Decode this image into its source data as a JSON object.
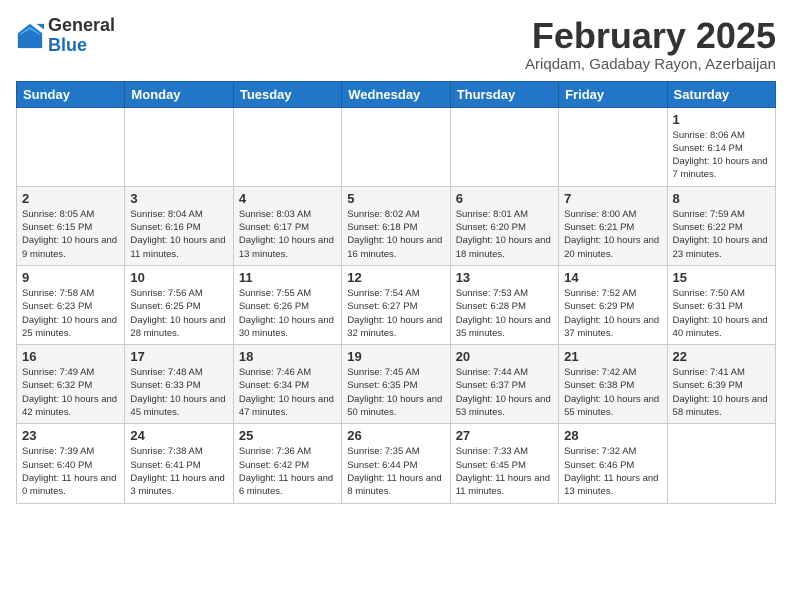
{
  "logo": {
    "general": "General",
    "blue": "Blue"
  },
  "title": "February 2025",
  "subtitle": "Ariqdam, Gadabay Rayon, Azerbaijan",
  "headers": [
    "Sunday",
    "Monday",
    "Tuesday",
    "Wednesday",
    "Thursday",
    "Friday",
    "Saturday"
  ],
  "weeks": [
    [
      {
        "day": "",
        "info": ""
      },
      {
        "day": "",
        "info": ""
      },
      {
        "day": "",
        "info": ""
      },
      {
        "day": "",
        "info": ""
      },
      {
        "day": "",
        "info": ""
      },
      {
        "day": "",
        "info": ""
      },
      {
        "day": "1",
        "info": "Sunrise: 8:06 AM\nSunset: 6:14 PM\nDaylight: 10 hours and 7 minutes."
      }
    ],
    [
      {
        "day": "2",
        "info": "Sunrise: 8:05 AM\nSunset: 6:15 PM\nDaylight: 10 hours and 9 minutes."
      },
      {
        "day": "3",
        "info": "Sunrise: 8:04 AM\nSunset: 6:16 PM\nDaylight: 10 hours and 11 minutes."
      },
      {
        "day": "4",
        "info": "Sunrise: 8:03 AM\nSunset: 6:17 PM\nDaylight: 10 hours and 13 minutes."
      },
      {
        "day": "5",
        "info": "Sunrise: 8:02 AM\nSunset: 6:18 PM\nDaylight: 10 hours and 16 minutes."
      },
      {
        "day": "6",
        "info": "Sunrise: 8:01 AM\nSunset: 6:20 PM\nDaylight: 10 hours and 18 minutes."
      },
      {
        "day": "7",
        "info": "Sunrise: 8:00 AM\nSunset: 6:21 PM\nDaylight: 10 hours and 20 minutes."
      },
      {
        "day": "8",
        "info": "Sunrise: 7:59 AM\nSunset: 6:22 PM\nDaylight: 10 hours and 23 minutes."
      }
    ],
    [
      {
        "day": "9",
        "info": "Sunrise: 7:58 AM\nSunset: 6:23 PM\nDaylight: 10 hours and 25 minutes."
      },
      {
        "day": "10",
        "info": "Sunrise: 7:56 AM\nSunset: 6:25 PM\nDaylight: 10 hours and 28 minutes."
      },
      {
        "day": "11",
        "info": "Sunrise: 7:55 AM\nSunset: 6:26 PM\nDaylight: 10 hours and 30 minutes."
      },
      {
        "day": "12",
        "info": "Sunrise: 7:54 AM\nSunset: 6:27 PM\nDaylight: 10 hours and 32 minutes."
      },
      {
        "day": "13",
        "info": "Sunrise: 7:53 AM\nSunset: 6:28 PM\nDaylight: 10 hours and 35 minutes."
      },
      {
        "day": "14",
        "info": "Sunrise: 7:52 AM\nSunset: 6:29 PM\nDaylight: 10 hours and 37 minutes."
      },
      {
        "day": "15",
        "info": "Sunrise: 7:50 AM\nSunset: 6:31 PM\nDaylight: 10 hours and 40 minutes."
      }
    ],
    [
      {
        "day": "16",
        "info": "Sunrise: 7:49 AM\nSunset: 6:32 PM\nDaylight: 10 hours and 42 minutes."
      },
      {
        "day": "17",
        "info": "Sunrise: 7:48 AM\nSunset: 6:33 PM\nDaylight: 10 hours and 45 minutes."
      },
      {
        "day": "18",
        "info": "Sunrise: 7:46 AM\nSunset: 6:34 PM\nDaylight: 10 hours and 47 minutes."
      },
      {
        "day": "19",
        "info": "Sunrise: 7:45 AM\nSunset: 6:35 PM\nDaylight: 10 hours and 50 minutes."
      },
      {
        "day": "20",
        "info": "Sunrise: 7:44 AM\nSunset: 6:37 PM\nDaylight: 10 hours and 53 minutes."
      },
      {
        "day": "21",
        "info": "Sunrise: 7:42 AM\nSunset: 6:38 PM\nDaylight: 10 hours and 55 minutes."
      },
      {
        "day": "22",
        "info": "Sunrise: 7:41 AM\nSunset: 6:39 PM\nDaylight: 10 hours and 58 minutes."
      }
    ],
    [
      {
        "day": "23",
        "info": "Sunrise: 7:39 AM\nSunset: 6:40 PM\nDaylight: 11 hours and 0 minutes."
      },
      {
        "day": "24",
        "info": "Sunrise: 7:38 AM\nSunset: 6:41 PM\nDaylight: 11 hours and 3 minutes."
      },
      {
        "day": "25",
        "info": "Sunrise: 7:36 AM\nSunset: 6:42 PM\nDaylight: 11 hours and 6 minutes."
      },
      {
        "day": "26",
        "info": "Sunrise: 7:35 AM\nSunset: 6:44 PM\nDaylight: 11 hours and 8 minutes."
      },
      {
        "day": "27",
        "info": "Sunrise: 7:33 AM\nSunset: 6:45 PM\nDaylight: 11 hours and 11 minutes."
      },
      {
        "day": "28",
        "info": "Sunrise: 7:32 AM\nSunset: 6:46 PM\nDaylight: 11 hours and 13 minutes."
      },
      {
        "day": "",
        "info": ""
      }
    ]
  ]
}
